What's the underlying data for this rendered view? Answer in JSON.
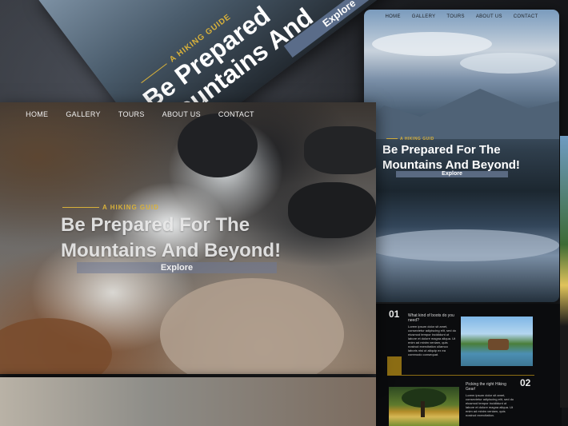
{
  "nav": {
    "home": "HOME",
    "gallery": "GALLERY",
    "tours": "TOURS",
    "about": "ABOUT US",
    "contact": "CONTACT"
  },
  "hero": {
    "tag": "A HIKING GUID",
    "title_line1": "Be Prepared For The",
    "title_line2": "Mountains And Beyond!",
    "button": "Explore"
  },
  "tilted": {
    "tag": "A HIKING GUIDE",
    "title": "Be Prepared",
    "title2": "Mountains And",
    "button": "Explore"
  },
  "features": [
    {
      "number": "01",
      "question": "What kind of boots do you need?",
      "body": "Lorem ipsum dolor sit amet, consectetur adipiscing elit, sed do eiusmod tempor incididunt ut labore et dolore magna aliqua. Ut enim ad minim veniam, quis nostrud exercitation ullamco laboris nisi ut aliquip ex ea commodo consequat."
    },
    {
      "number": "02",
      "question": "Picking the right Hiking Gear!",
      "body": "Lorem ipsum dolor sit amet, consectetur adipiscing elit, sed do eiusmod tempor incididunt ut labore et dolore magna aliqua. Ut enim ad minim veniam, quis nostrud exercitation."
    }
  ],
  "colors": {
    "accent": "#d8b13a",
    "button": "#5a6a82"
  }
}
